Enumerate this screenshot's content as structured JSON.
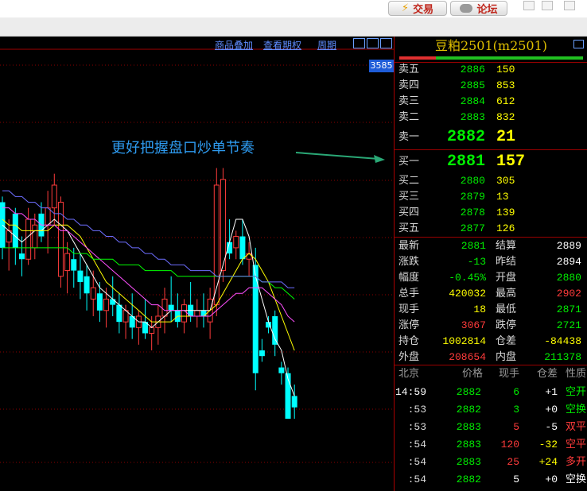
{
  "titlebar": {
    "trade_label": "交易",
    "forum_label": "论坛",
    "trade_icon": "lightning-icon",
    "forum_icon": "chat-bubble-icon"
  },
  "chart": {
    "menu": [
      "商品叠加",
      "查看期权",
      "周期"
    ],
    "price_tag": "3585",
    "annotation": "更好把握盘口炒单节奏",
    "colors": {
      "up": "#00ffff",
      "down": "#ff3b3b",
      "ma1": "#ffffff",
      "ma2": "#ffff00",
      "ma3": "#ff50ff",
      "ma4": "#00ff00",
      "ma5": "#6e6eff"
    }
  },
  "chart_data": {
    "type": "candlestick",
    "ylim": [
      2860,
      2935
    ],
    "candles": [
      {
        "o": 2909,
        "h": 2910,
        "l": 2899,
        "c": 2901
      },
      {
        "o": 2902,
        "h": 2906,
        "l": 2897,
        "c": 2904
      },
      {
        "o": 2907,
        "h": 2908,
        "l": 2898,
        "c": 2901
      },
      {
        "o": 2900,
        "h": 2903,
        "l": 2896,
        "c": 2899
      },
      {
        "o": 2899,
        "h": 2908,
        "l": 2898,
        "c": 2906
      },
      {
        "o": 2901,
        "h": 2907,
        "l": 2899,
        "c": 2905
      },
      {
        "o": 2907,
        "h": 2909,
        "l": 2902,
        "c": 2903
      },
      {
        "o": 2905,
        "h": 2911,
        "l": 2900,
        "c": 2908
      },
      {
        "o": 2908,
        "h": 2914,
        "l": 2905,
        "c": 2912
      },
      {
        "o": 2896,
        "h": 2910,
        "l": 2894,
        "c": 2909
      },
      {
        "o": 2897,
        "h": 2902,
        "l": 2893,
        "c": 2900
      },
      {
        "o": 2899,
        "h": 2901,
        "l": 2894,
        "c": 2897
      },
      {
        "o": 2897,
        "h": 2900,
        "l": 2892,
        "c": 2895
      },
      {
        "o": 2896,
        "h": 2898,
        "l": 2890,
        "c": 2893
      },
      {
        "o": 2892,
        "h": 2897,
        "l": 2889,
        "c": 2894
      },
      {
        "o": 2893,
        "h": 2895,
        "l": 2888,
        "c": 2890
      },
      {
        "o": 2890,
        "h": 2894,
        "l": 2887,
        "c": 2892
      },
      {
        "o": 2892,
        "h": 2896,
        "l": 2889,
        "c": 2891
      },
      {
        "o": 2891,
        "h": 2893,
        "l": 2886,
        "c": 2888
      },
      {
        "o": 2888,
        "h": 2891,
        "l": 2885,
        "c": 2890
      },
      {
        "o": 2889,
        "h": 2893,
        "l": 2885,
        "c": 2887
      },
      {
        "o": 2887,
        "h": 2890,
        "l": 2884,
        "c": 2889
      },
      {
        "o": 2888,
        "h": 2892,
        "l": 2885,
        "c": 2886
      },
      {
        "o": 2886,
        "h": 2889,
        "l": 2883,
        "c": 2887
      },
      {
        "o": 2887,
        "h": 2891,
        "l": 2884,
        "c": 2889
      },
      {
        "o": 2889,
        "h": 2894,
        "l": 2886,
        "c": 2892
      },
      {
        "o": 2891,
        "h": 2896,
        "l": 2888,
        "c": 2890
      },
      {
        "o": 2890,
        "h": 2893,
        "l": 2887,
        "c": 2888
      },
      {
        "o": 2888,
        "h": 2892,
        "l": 2886,
        "c": 2891
      },
      {
        "o": 2891,
        "h": 2895,
        "l": 2888,
        "c": 2889
      },
      {
        "o": 2889,
        "h": 2892,
        "l": 2887,
        "c": 2890
      },
      {
        "o": 2890,
        "h": 2893,
        "l": 2887,
        "c": 2889
      },
      {
        "o": 2888,
        "h": 2894,
        "l": 2885,
        "c": 2892
      },
      {
        "o": 2891,
        "h": 2915,
        "l": 2889,
        "c": 2912
      },
      {
        "o": 2897,
        "h": 2915,
        "l": 2895,
        "c": 2913
      },
      {
        "o": 2902,
        "h": 2906,
        "l": 2899,
        "c": 2900
      },
      {
        "o": 2901,
        "h": 2904,
        "l": 2899,
        "c": 2903
      },
      {
        "o": 2903,
        "h": 2906,
        "l": 2898,
        "c": 2899
      },
      {
        "o": 2899,
        "h": 2902,
        "l": 2896,
        "c": 2900
      },
      {
        "o": 2898,
        "h": 2901,
        "l": 2876,
        "c": 2879
      },
      {
        "o": 2883,
        "h": 2885,
        "l": 2881,
        "c": 2882
      },
      {
        "o": 2888,
        "h": 2889,
        "l": 2886,
        "c": 2887
      },
      {
        "o": 2889,
        "h": 2890,
        "l": 2882,
        "c": 2884
      },
      {
        "o": 2880,
        "h": 2881,
        "l": 2877,
        "c": 2879
      },
      {
        "o": 2879,
        "h": 2880,
        "l": 2871,
        "c": 2871
      },
      {
        "o": 2875,
        "h": 2877,
        "l": 2871,
        "c": 2873
      }
    ],
    "ma": [
      {
        "name": "MA5",
        "color": "#ffffff",
        "values": [
          2905,
          2904,
          2903,
          2902,
          2903,
          2904,
          2904,
          2905,
          2906,
          2905,
          2904,
          2902,
          2900,
          2898,
          2896,
          2894,
          2893,
          2892,
          2891,
          2890,
          2889,
          2888,
          2888,
          2887,
          2888,
          2889,
          2890,
          2890,
          2890,
          2890,
          2890,
          2890,
          2890,
          2894,
          2898,
          2902,
          2906,
          2906,
          2903,
          2896,
          2892,
          2888,
          2885,
          2883,
          2878,
          2875
        ]
      },
      {
        "name": "MA10",
        "color": "#ffff00",
        "values": [
          2906,
          2905,
          2905,
          2904,
          2904,
          2904,
          2904,
          2904,
          2905,
          2905,
          2905,
          2904,
          2903,
          2901,
          2899,
          2897,
          2895,
          2894,
          2893,
          2892,
          2891,
          2890,
          2889,
          2888,
          2888,
          2888,
          2888,
          2889,
          2889,
          2889,
          2889,
          2889,
          2890,
          2891,
          2893,
          2895,
          2897,
          2899,
          2900,
          2899,
          2897,
          2895,
          2892,
          2889,
          2886,
          2883
        ]
      },
      {
        "name": "MA20",
        "color": "#ff50ff",
        "values": [
          2908,
          2908,
          2907,
          2907,
          2906,
          2906,
          2905,
          2905,
          2905,
          2904,
          2904,
          2903,
          2902,
          2901,
          2900,
          2899,
          2898,
          2897,
          2896,
          2895,
          2894,
          2893,
          2892,
          2891,
          2891,
          2890,
          2890,
          2890,
          2890,
          2889,
          2889,
          2889,
          2889,
          2890,
          2891,
          2892,
          2893,
          2893,
          2894,
          2894,
          2894,
          2893,
          2892,
          2891,
          2889,
          2888
        ]
      },
      {
        "name": "MA40",
        "color": "#00ff00",
        "values": [
          2901,
          2901,
          2901,
          2901,
          2901,
          2901,
          2901,
          2901,
          2901,
          2901,
          2901,
          2900,
          2900,
          2900,
          2899,
          2899,
          2899,
          2899,
          2898,
          2898,
          2898,
          2898,
          2897,
          2897,
          2897,
          2897,
          2897,
          2896,
          2896,
          2896,
          2896,
          2896,
          2896,
          2896,
          2896,
          2896,
          2896,
          2896,
          2896,
          2896,
          2895,
          2895,
          2894,
          2894,
          2893,
          2892
        ]
      },
      {
        "name": "MA60",
        "color": "#6e6eff",
        "values": [
          2911,
          2911,
          2910,
          2910,
          2909,
          2909,
          2908,
          2908,
          2907,
          2907,
          2906,
          2906,
          2905,
          2905,
          2904,
          2904,
          2903,
          2903,
          2902,
          2902,
          2901,
          2901,
          2900,
          2900,
          2899,
          2899,
          2898,
          2898,
          2898,
          2897,
          2897,
          2897,
          2897,
          2896,
          2896,
          2896,
          2896,
          2896,
          2896,
          2896,
          2895,
          2895,
          2895,
          2895,
          2894,
          2894
        ]
      }
    ]
  },
  "contract": {
    "title": "豆粕2501(m2501)"
  },
  "asks": [
    {
      "label": "卖五",
      "price": "2886",
      "vol": "150"
    },
    {
      "label": "卖四",
      "price": "2885",
      "vol": "853"
    },
    {
      "label": "卖三",
      "price": "2884",
      "vol": "612"
    },
    {
      "label": "卖二",
      "price": "2883",
      "vol": "832"
    },
    {
      "label": "卖一",
      "price": "2882",
      "vol": "21"
    }
  ],
  "bids": [
    {
      "label": "买一",
      "price": "2881",
      "vol": "157"
    },
    {
      "label": "买二",
      "price": "2880",
      "vol": "305"
    },
    {
      "label": "买三",
      "price": "2879",
      "vol": "13"
    },
    {
      "label": "买四",
      "price": "2878",
      "vol": "139"
    },
    {
      "label": "买五",
      "price": "2877",
      "vol": "126"
    }
  ],
  "stats": [
    {
      "l1": "最新",
      "v1": "2881",
      "c1": "#00ee00",
      "l2": "结算",
      "v2": "2889",
      "c2": "#ffffff"
    },
    {
      "l1": "涨跌",
      "v1": "-13",
      "c1": "#00ee00",
      "l2": "昨结",
      "v2": "2894",
      "c2": "#ffffff"
    },
    {
      "l1": "幅度",
      "v1": "-0.45%",
      "c1": "#00ee00",
      "l2": "开盘",
      "v2": "2880",
      "c2": "#00ee00"
    },
    {
      "l1": "总手",
      "v1": "420032",
      "c1": "#ffff00",
      "l2": "最高",
      "v2": "2902",
      "c2": "#ff3b3b"
    },
    {
      "l1": "现手",
      "v1": "18",
      "c1": "#ffff00",
      "l2": "最低",
      "v2": "2871",
      "c2": "#00ee00"
    },
    {
      "l1": "涨停",
      "v1": "3067",
      "c1": "#ff3b3b",
      "l2": "跌停",
      "v2": "2721",
      "c2": "#00ee00"
    },
    {
      "l1": "持仓",
      "v1": "1002814",
      "c1": "#ffff00",
      "l2": "仓差",
      "v2": "-84438",
      "c2": "#ffff00"
    },
    {
      "l1": "外盘",
      "v1": "208654",
      "c1": "#ff3b3b",
      "l2": "内盘",
      "v2": "211378",
      "c2": "#00ee00"
    }
  ],
  "ticks_header": [
    "北京",
    "价格",
    "现手",
    "仓差",
    "性质"
  ],
  "ticks": [
    {
      "time": "14:59",
      "price": "2882",
      "vol": "6",
      "oi": "+1",
      "type": "空开",
      "vc": "#00ee00",
      "oc": "#ffffff",
      "tc": "#00ee00"
    },
    {
      "time": ":53",
      "price": "2882",
      "vol": "3",
      "oi": "+0",
      "type": "空换",
      "vc": "#00ee00",
      "oc": "#ffffff",
      "tc": "#00ee00"
    },
    {
      "time": ":53",
      "price": "2883",
      "vol": "5",
      "oi": "-5",
      "type": "双平",
      "vc": "#ff3b3b",
      "oc": "#ffffff",
      "tc": "#ff3b3b"
    },
    {
      "time": ":54",
      "price": "2883",
      "vol": "120",
      "oi": "-32",
      "type": "空平",
      "vc": "#ff3b3b",
      "oc": "#ffff00",
      "tc": "#ff3b3b"
    },
    {
      "time": ":54",
      "price": "2883",
      "vol": "25",
      "oi": "+24",
      "type": "多开",
      "vc": "#ff3b3b",
      "oc": "#ffff00",
      "tc": "#ff3b3b"
    },
    {
      "time": ":54",
      "price": "2882",
      "vol": "5",
      "oi": "+0",
      "type": "空换",
      "vc": "#ffffff",
      "oc": "#ffffff",
      "tc": "#ffffff"
    }
  ]
}
